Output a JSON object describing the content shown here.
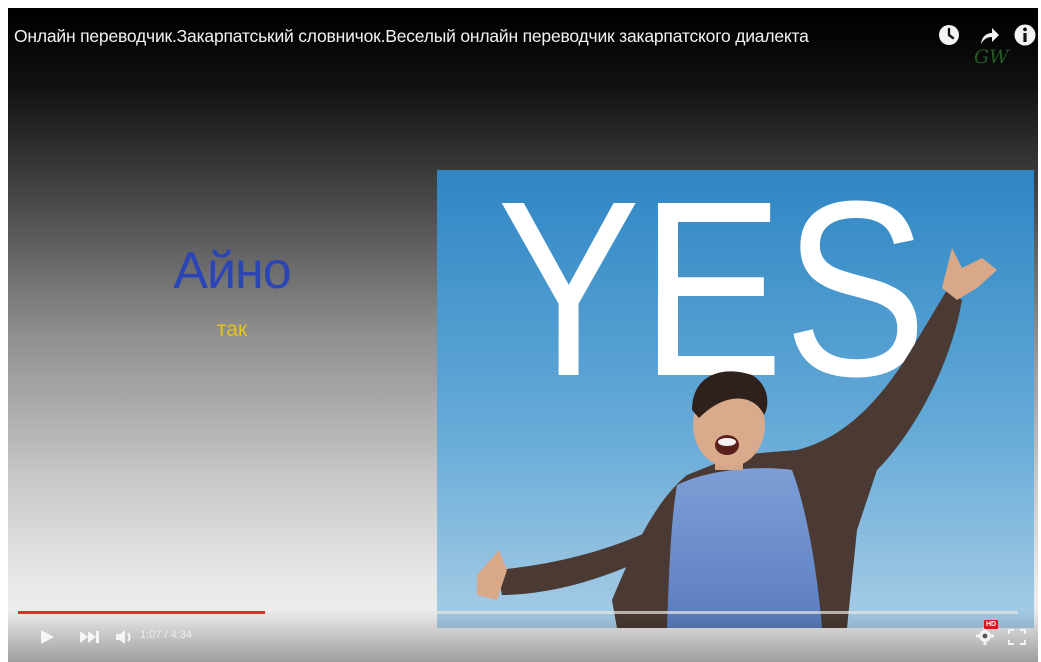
{
  "video": {
    "title": "Онлайн переводчик.Закарпатський словничок.Веселый онлайн переводчик закарпатского диалекта",
    "watermark": "GW"
  },
  "slide": {
    "word": "Айно",
    "translation": "так",
    "photo_text": "YES"
  },
  "top_icons": [
    "watch-later-icon",
    "share-icon",
    "info-icon"
  ],
  "controls": {
    "time_display": "1:07 / 4:34",
    "progress_fraction": 0.247,
    "quality_badge": "HD",
    "colors": {
      "progress": "#e52d27",
      "badge": "#cc1e1e"
    }
  }
}
